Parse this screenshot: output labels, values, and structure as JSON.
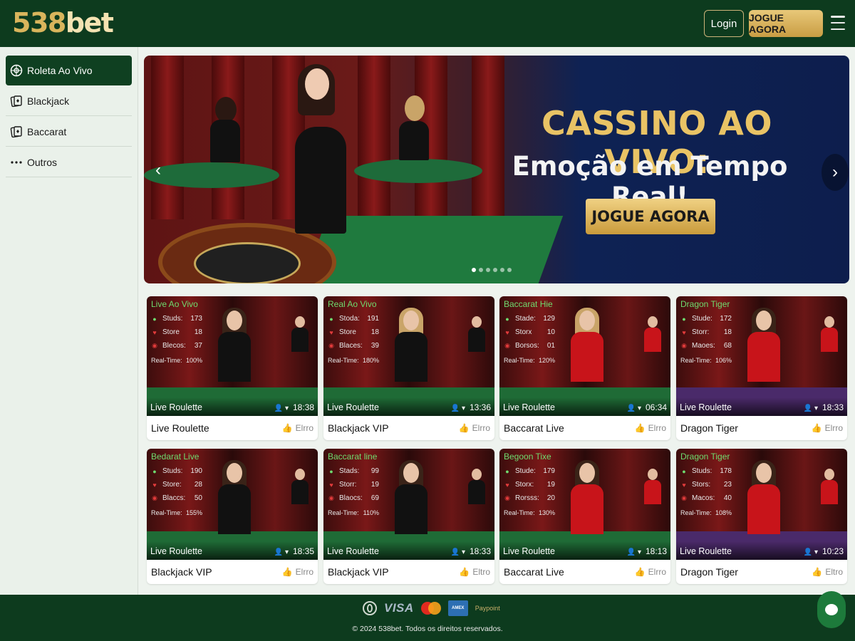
{
  "header": {
    "logo_num": "538",
    "logo_txt": "bet",
    "login_label": "Login",
    "jogue_label": "JOGUE AGORA"
  },
  "sidebar": {
    "items": [
      {
        "label": "Roleta Ao Vivo",
        "icon": "roulette-icon",
        "active": true
      },
      {
        "label": "Blackjack",
        "icon": "cards-icon",
        "active": false
      },
      {
        "label": "Baccarat",
        "icon": "cards-icon",
        "active": false
      },
      {
        "label": "Outros",
        "icon": "more-dots-icon",
        "active": false
      }
    ]
  },
  "banner": {
    "title": "CASSINO AO VIVO:",
    "subtitle": "Emoção em Tempo Real!",
    "cta": "JOGUE AGORA",
    "active_slide": 1,
    "slide_count": 6
  },
  "games": [
    {
      "tag": "Live Ao Vivo",
      "s1l": "Studs:",
      "s1v": "173",
      "s2l": "Store",
      "s2v": "18",
      "s3l": "Blecos:",
      "s3v": "37",
      "rt_label": "Real-Time:",
      "rt_val": "100%",
      "overlay": "Live Roulette",
      "time": "18:38",
      "title": "Live Roulette",
      "like": "Elrro",
      "theme": "red"
    },
    {
      "tag": "Real Ao Vivo",
      "s1l": "Stoda:",
      "s1v": "191",
      "s2l": "Store",
      "s2v": "18",
      "s3l": "Blaces:",
      "s3v": "39",
      "rt_label": "Real-Time:",
      "rt_val": "180%",
      "overlay": "Live Roulette",
      "time": "13:36",
      "title": "Blackjack VIP",
      "like": "Elrro",
      "theme": "red"
    },
    {
      "tag": "Baccarat Hie",
      "s1l": "Stade:",
      "s1v": "129",
      "s2l": "Storx",
      "s2v": "10",
      "s3l": "Borsos:",
      "s3v": "01",
      "rt_label": "Real-Time:",
      "rt_val": "120%",
      "overlay": "Live Roulette",
      "time": "06:34",
      "title": "Baccarat Live",
      "like": "Elrro",
      "theme": "red"
    },
    {
      "tag": "Dragon Tiger",
      "s1l": "Stude:",
      "s1v": "172",
      "s2l": "Storr:",
      "s2v": "18",
      "s3l": "Maoes:",
      "s3v": "68",
      "rt_label": "Real-Time:",
      "rt_val": "106%",
      "overlay": "Live Roulette",
      "time": "18:33",
      "title": "Dragon Tiger",
      "like": "Elrro",
      "theme": "purple"
    },
    {
      "tag": "Bedarat Live",
      "s1l": "Studs:",
      "s1v": "190",
      "s2l": "Store:",
      "s2v": "28",
      "s3l": "Blaccs:",
      "s3v": "50",
      "rt_label": "Real-Time:",
      "rt_val": "155%",
      "overlay": "Live Roulette",
      "time": "18:35",
      "title": "Blackjack VIP",
      "like": "Elrro",
      "theme": "red"
    },
    {
      "tag": "Baccarat line",
      "s1l": "Stads:",
      "s1v": "99",
      "s2l": "Storr:",
      "s2v": "19",
      "s3l": "Blaocs:",
      "s3v": "69",
      "rt_label": "Real-Time:",
      "rt_val": "110%",
      "overlay": "Live Roulette",
      "time": "18:33",
      "title": "Blackjack VIP",
      "like": "Eltro",
      "theme": "red"
    },
    {
      "tag": "Begoon Tixe",
      "s1l": "Stude:",
      "s1v": "179",
      "s2l": "Storx:",
      "s2v": "19",
      "s3l": "Rorsss:",
      "s3v": "20",
      "rt_label": "Real-Time:",
      "rt_val": "130%",
      "overlay": "Live Roulette",
      "time": "18:13",
      "title": "Baccarat Live",
      "like": "Elrro",
      "theme": "red"
    },
    {
      "tag": "Dragon Tiger",
      "s1l": "Studs:",
      "s1v": "178",
      "s2l": "Stors:",
      "s2v": "23",
      "s3l": "Macos:",
      "s3v": "40",
      "rt_label": "Real-Time:",
      "rt_val": "108%",
      "overlay": "Live Roulette",
      "time": "10:23",
      "title": "Dragon Tiger",
      "like": "Eltro",
      "theme": "purple"
    }
  ],
  "footer": {
    "payments": [
      "diners-icon",
      "VISA",
      "mastercard-icon",
      "amex-icon",
      "Paypoint"
    ],
    "copyright": "© 2024 538bet. Todos os direitos reservados."
  },
  "colors": {
    "brand_green": "#0d3b1e",
    "gold": "#d9b55c",
    "accent_green": "#6fdb6f"
  }
}
